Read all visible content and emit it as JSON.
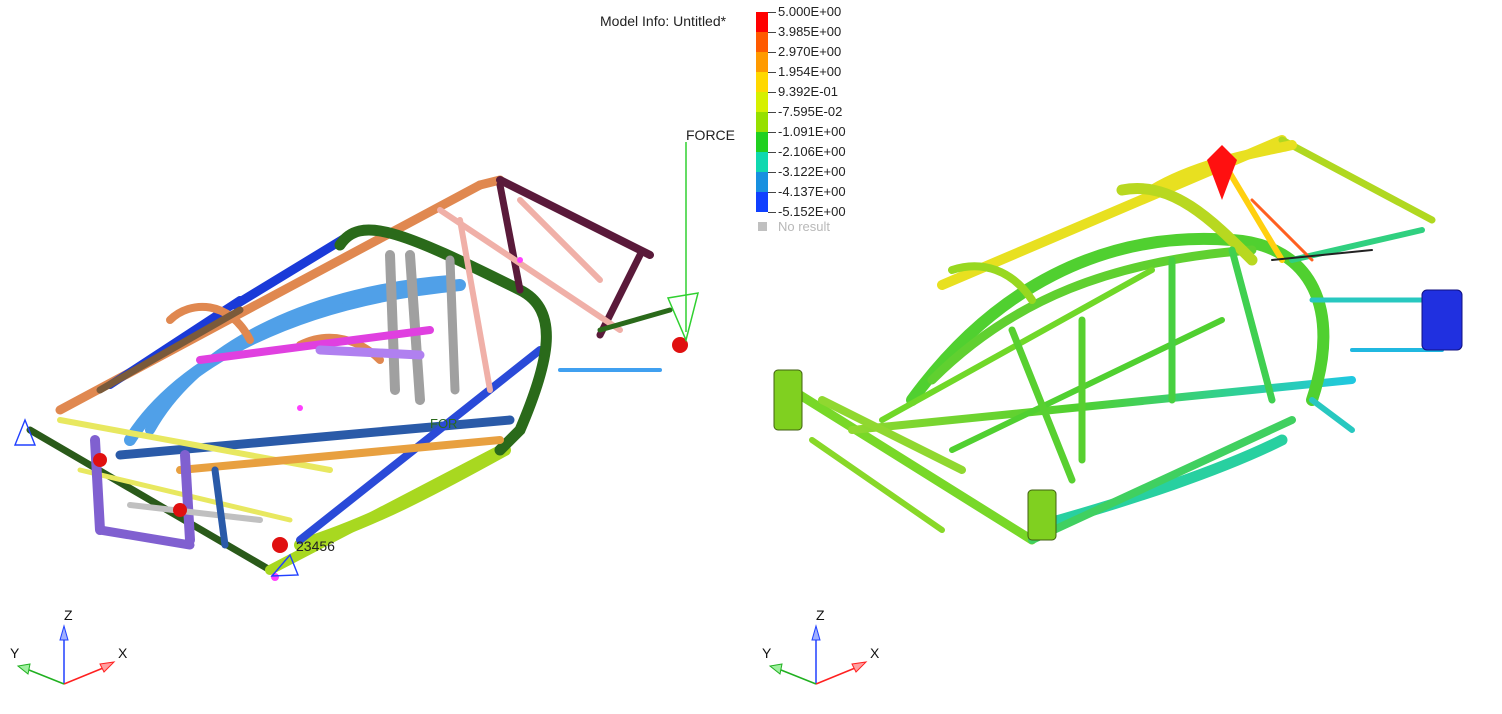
{
  "model_info": "Model Info: Untitled*",
  "legend": {
    "labels": [
      "5.000E+00",
      "3.985E+00",
      "2.970E+00",
      "1.954E+00",
      "9.392E-01",
      "-7.595E-02",
      "-1.091E+00",
      "-2.106E+00",
      "-3.122E+00",
      "-4.137E+00",
      "-5.152E+00"
    ],
    "colors": [
      "#ff0000",
      "#ff5a00",
      "#ff9a00",
      "#ffd800",
      "#d6f000",
      "#96e000",
      "#20d020",
      "#10d8b0",
      "#1890e0",
      "#1040ff",
      "#0000c8"
    ],
    "no_result": "No result"
  },
  "left_view": {
    "force_label": "FORCE",
    "node_label": "23456",
    "force_label_small": "FOR"
  },
  "triad_left": {
    "x": "X",
    "y": "Y",
    "z": "Z"
  },
  "triad_right": {
    "x": "X",
    "y": "Y",
    "z": "Z"
  }
}
